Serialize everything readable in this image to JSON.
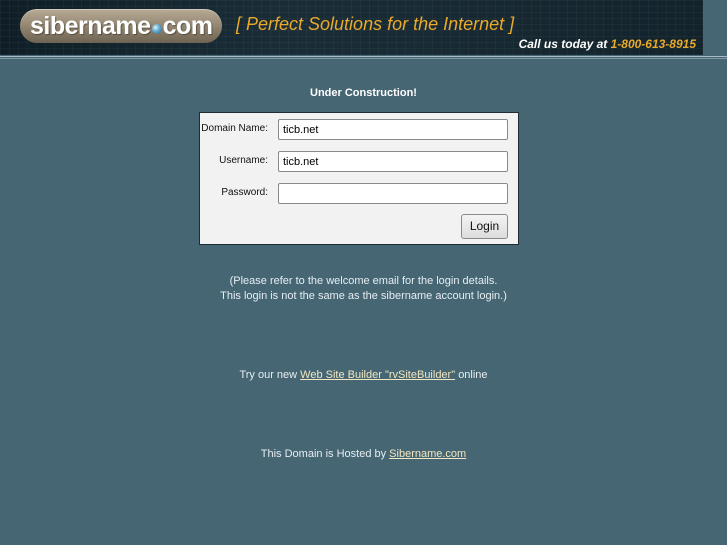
{
  "header": {
    "logo_left": "sibername",
    "logo_right": "com",
    "tagline": "[ Perfect Solutions for the Internet ]",
    "call_us": "Call us today at",
    "phone": "1-800-613-8915"
  },
  "main": {
    "heading": "Under Construction!",
    "form": {
      "domain_label": "Domain Name:",
      "domain_value": "ticb.net",
      "username_label": "Username:",
      "username_value": "ticb.net",
      "password_label": "Password:",
      "password_value": "",
      "login_label": "Login"
    },
    "note_line1": "(Please refer to the welcome email for the login details.",
    "note_line2": "This login is not the same as the sibername account login.)",
    "builder_prefix": "Try our new",
    "builder_link": "Web Site Builder \"rvSiteBuilder\"",
    "builder_suffix": "online",
    "hosted_prefix": "This Domain is Hosted by",
    "hosted_link": "Sibername.com"
  },
  "colors": {
    "background": "#476674",
    "accent": "#e9a92a",
    "link": "#f1e7c0"
  }
}
